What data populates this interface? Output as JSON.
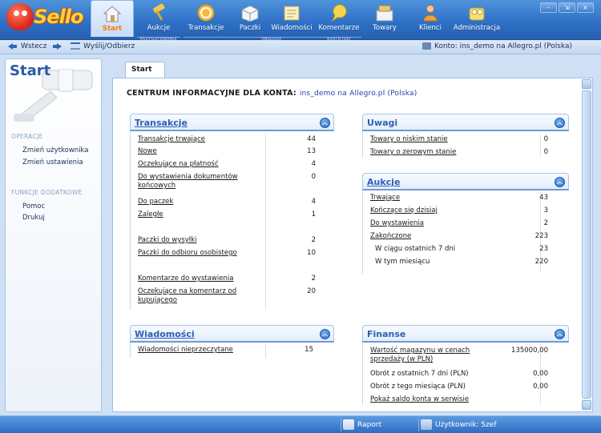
{
  "app": {
    "logo_text": "Sello"
  },
  "nav": [
    {
      "label": "Start",
      "icon": "house-icon",
      "active": true
    },
    {
      "label": "Aukcje",
      "icon": "gavel-icon"
    },
    {
      "label": "Transakcje",
      "icon": "coin-icon"
    },
    {
      "label": "Paczki",
      "icon": "box-icon"
    },
    {
      "label": "Wiadomości",
      "icon": "envelope-icon"
    },
    {
      "label": "Komentarze",
      "icon": "comment-icon"
    },
    {
      "label": "Towary",
      "icon": "goods-icon"
    },
    {
      "label": "Klienci",
      "icon": "person-icon"
    },
    {
      "label": "Administracja",
      "icon": "admin-icon"
    }
  ],
  "nav_groups": [
    "PRZYGOTOWANIE",
    "OBSŁUGA",
    "KARTOTEKI"
  ],
  "window_controls": {
    "minimize": "–",
    "restore": "⇲",
    "close": "×"
  },
  "subbar": {
    "back": "Wstecz",
    "send_receive": "Wyślij/Odbierz",
    "account": "Konto: ins_demo na Allegro.pl (Polska)"
  },
  "sidebar": {
    "title": "Start",
    "sections": [
      {
        "heading": "OPERACJE",
        "items": [
          "Zmień użytkownika",
          "Zmień ustawienia"
        ]
      },
      {
        "heading": "FUNKCJE DODATKOWE",
        "items": [
          "Pomoc",
          "Drukuj"
        ]
      }
    ]
  },
  "tab": "Start",
  "headline": {
    "label": "CENTRUM INFORMACYJNE DLA KONTA:",
    "account": "ins_demo na Allegro.pl (Polska)"
  },
  "transakcje": {
    "title": "Transakcje",
    "rows": [
      {
        "label": "Transakcje trwające",
        "value": "44"
      },
      {
        "label": "Nowe",
        "value": "13"
      },
      {
        "label": "Oczekujące na płatność",
        "value": "4"
      },
      {
        "label": "Do wystawienia dokumentów",
        "label2": "końcowych",
        "value": "0"
      },
      {
        "label": "Do paczek",
        "value": "4"
      },
      {
        "label": "Zaległe",
        "value": "1"
      },
      {
        "label": "Paczki do wysyłki",
        "value": "2"
      },
      {
        "label": "Paczki do odbioru osobistego",
        "value": "10"
      },
      {
        "label": "Komentarze do wystawienia",
        "value": "2"
      },
      {
        "label": "Oczekujące na komentarz od",
        "label2": "kupującego",
        "value": "20"
      }
    ]
  },
  "uwagi": {
    "title": "Uwagi",
    "rows": [
      {
        "label": "Towary o niskim stanie",
        "value": "0"
      },
      {
        "label": "Towary o zerowym stanie",
        "value": "0"
      }
    ]
  },
  "aukcje": {
    "title": "Aukcje",
    "rows": [
      {
        "label": "Trwające",
        "value": "43"
      },
      {
        "label": "Kończące się dzisiaj",
        "value": "3"
      },
      {
        "label": "Do wystawienia",
        "value": "2"
      },
      {
        "label": "Zakończone",
        "value": "223"
      },
      {
        "label": "W ciągu ostatnich 7 dni",
        "value": "23"
      },
      {
        "label": "W tym miesiącu",
        "value": "220"
      }
    ]
  },
  "wiadomosci": {
    "title": "Wiadomości",
    "rows": [
      {
        "label": "Wiadomości nieprzeczytane",
        "value": "15"
      }
    ]
  },
  "finanse": {
    "title": "Finanse",
    "rows": [
      {
        "label": "Wartość magazynu w cenach",
        "label2": "sprzedaży (w PLN)",
        "value": "135000,00"
      },
      {
        "label": "Obrót z ostatnich 7 dni (PLN)",
        "value": "0,00"
      },
      {
        "label": "Obrót z tego miesiąca (PLN)",
        "value": "0,00"
      },
      {
        "label": "Pokaż saldo konta w serwisie",
        "value": ""
      }
    ]
  },
  "statusbar": {
    "report": "Raport",
    "user": "Użytkownik: Szef"
  },
  "colors": {
    "accent": "#2f5fb0",
    "toolbar": "#2d6fc4",
    "active_tab_label": "#ff7a00"
  }
}
